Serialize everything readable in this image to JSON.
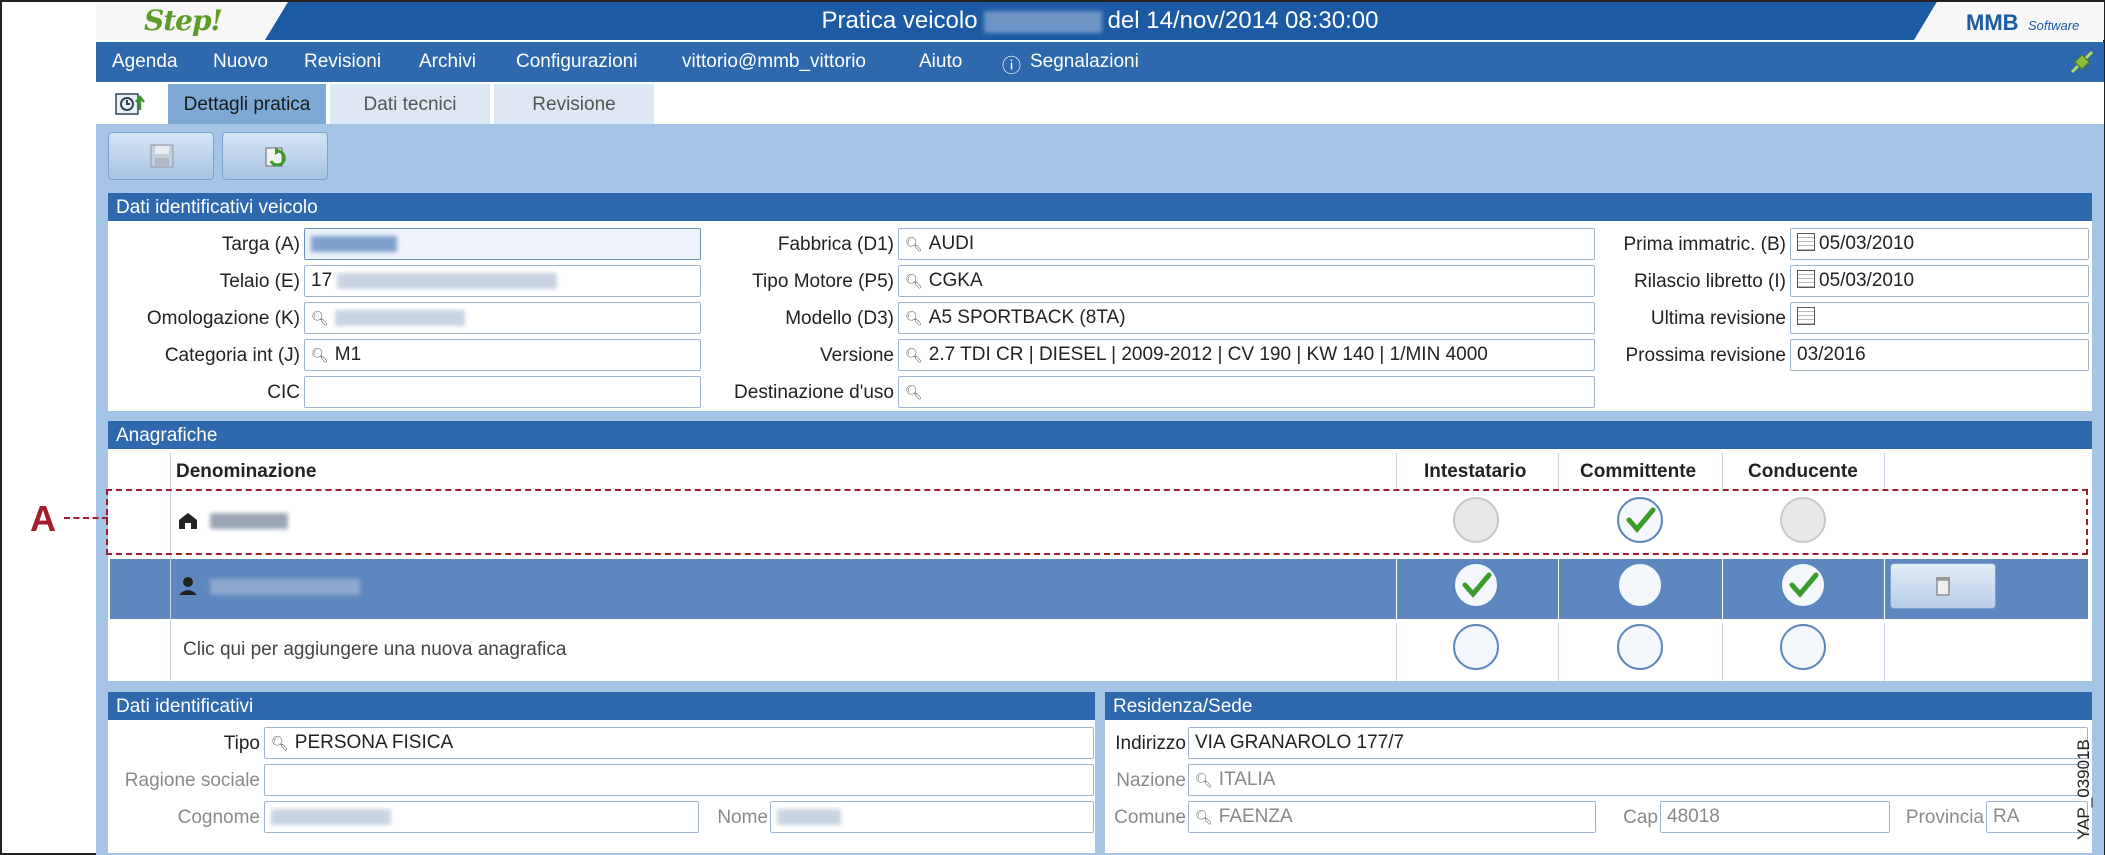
{
  "window": {
    "title_prefix": "Pratica veicolo",
    "title_suffix": "del 14/nov/2014 08:30:00",
    "logo_left": "Step!",
    "logo_right_main": "MMB",
    "logo_right_sub": "Software"
  },
  "menu": {
    "items": [
      "Agenda",
      "Nuovo",
      "Revisioni",
      "Archivi",
      "Configurazioni",
      "vittorio@mmb_vittorio",
      "Aiuto",
      "Segnalazioni"
    ],
    "info_glyph": "ⓘ"
  },
  "tabs": [
    "Dettagli pratica",
    "Dati tecnici",
    "Revisione"
  ],
  "sections": {
    "vehicle": "Dati identificativi veicolo",
    "registry": "Anagrafiche",
    "ident": "Dati identificativi",
    "residence": "Residenza/Sede"
  },
  "vehicle": {
    "labels": {
      "targa": "Targa (A)",
      "telaio": "Telaio (E)",
      "omologazione": "Omologazione (K)",
      "categoria": "Categoria int (J)",
      "cic": "CIC",
      "fabbrica": "Fabbrica (D1)",
      "tipo_motore": "Tipo Motore (P5)",
      "modello": "Modello (D3)",
      "versione": "Versione",
      "destinazione": "Destinazione d'uso",
      "prima_immatric": "Prima immatric. (B)",
      "rilascio": "Rilascio libretto (I)",
      "ultima_rev": "Ultima revisione",
      "prossima_rev": "Prossima revisione"
    },
    "values": {
      "telaio_prefix": "17",
      "categoria": "M1",
      "fabbrica": "AUDI",
      "tipo_motore": "CGKA",
      "modello": "A5 SPORTBACK (8TA)",
      "versione": "2.7 TDI CR | DIESEL | 2009-2012 | CV 190 | KW 140 | 1/MIN 4000",
      "prima_immatric": "05/03/2010",
      "rilascio": "05/03/2010",
      "prossima_rev": "03/2016"
    }
  },
  "registry": {
    "columns": [
      "Denominazione",
      "Intestatario",
      "Committente",
      "Conducente"
    ],
    "add_text": "Clic qui per aggiungere una nuova anagrafica",
    "rows": [
      {
        "intestatario": false,
        "committente": true,
        "conducente": false,
        "enabled": [
          false,
          true,
          false
        ]
      },
      {
        "intestatario": true,
        "committente": false,
        "conducente": true,
        "selected": true
      },
      {
        "intestatario": false,
        "committente": false,
        "conducente": false
      }
    ],
    "annotation_marker": "A"
  },
  "ident": {
    "labels": {
      "tipo": "Tipo",
      "ragione": "Ragione sociale",
      "cognome": "Cognome",
      "nome": "Nome"
    },
    "values": {
      "tipo": "PERSONA FISICA"
    }
  },
  "residence": {
    "labels": {
      "indirizzo": "Indirizzo",
      "nazione": "Nazione",
      "comune": "Comune",
      "cap": "Cap",
      "provincia": "Provincia"
    },
    "values": {
      "indirizzo": "VIA GRANAROLO 177/7",
      "nazione": "ITALIA",
      "comune": "FAENZA",
      "cap": "48018",
      "provincia": "RA"
    }
  },
  "figure_code": "YAP_03901B",
  "colors": {
    "title": "#1c5aa3",
    "menu": "#2f69ad",
    "panel": "#a6c5e6",
    "selected_row": "#5e87bf",
    "annotation": "#a11d2b",
    "check": "#3a9a2a"
  }
}
